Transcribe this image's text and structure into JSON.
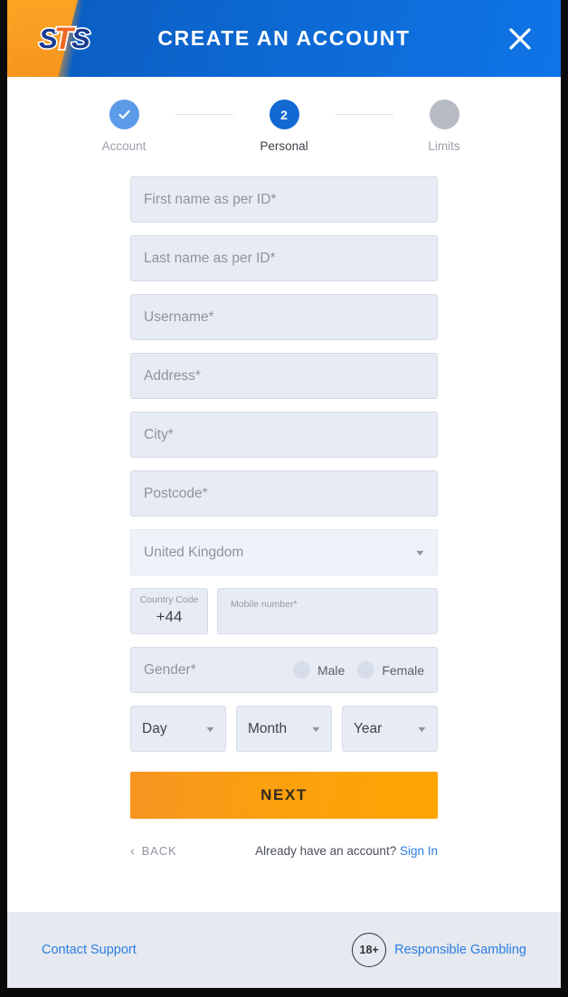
{
  "header": {
    "title": "CREATE AN ACCOUNT",
    "logo_text": "STS",
    "close_icon": "close-icon",
    "brand_orange": "#f99b1c",
    "brand_blue": "#0d6ad5"
  },
  "stepper": {
    "steps": [
      {
        "label": "Account",
        "state": "done",
        "marker": "check-icon"
      },
      {
        "label": "Personal",
        "state": "active",
        "marker": "2"
      },
      {
        "label": "Limits",
        "state": "todo",
        "marker": ""
      }
    ]
  },
  "form": {
    "first_name": {
      "placeholder": "First name as per ID*",
      "value": ""
    },
    "last_name": {
      "placeholder": "Last name as per ID*",
      "value": ""
    },
    "username": {
      "placeholder": "Username*",
      "value": ""
    },
    "address": {
      "placeholder": "Address*",
      "value": ""
    },
    "city": {
      "placeholder": "City*",
      "value": ""
    },
    "postcode": {
      "placeholder": "Postcode*",
      "value": ""
    },
    "country": {
      "selected": "United Kingdom",
      "caret": "chevron-down-icon"
    },
    "country_code": {
      "label": "Country Code",
      "value": "+44"
    },
    "mobile": {
      "placeholder": "Mobile number*",
      "value": ""
    },
    "gender": {
      "label": "Gender*",
      "options": [
        {
          "label": "Male",
          "selected": false
        },
        {
          "label": "Female",
          "selected": false
        }
      ]
    },
    "birth_date": {
      "day": {
        "selected": "Day"
      },
      "month": {
        "selected": "Month"
      },
      "year": {
        "selected": "Year"
      }
    }
  },
  "actions": {
    "next_label": "NEXT",
    "back_label": "BACK",
    "signin_prompt": "Already have an account?",
    "signin_label": "Sign In"
  },
  "footer": {
    "contact_label": "Contact Support",
    "age_badge": "18+",
    "responsible_label": "Responsible Gambling"
  }
}
